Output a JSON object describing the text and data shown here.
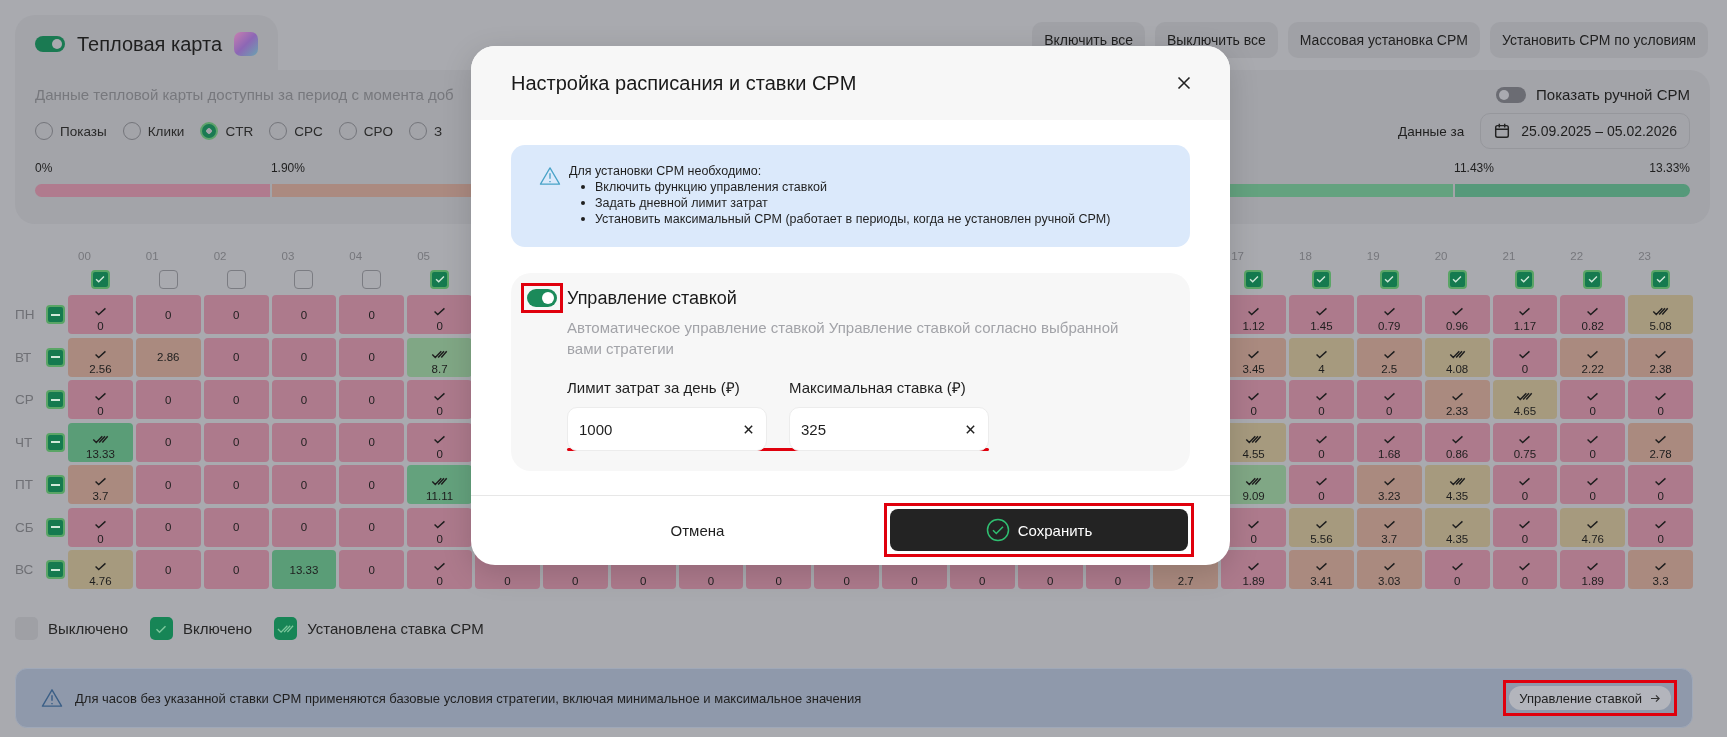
{
  "heatmap_tab": {
    "title": "Тепловая карта",
    "enabled": true
  },
  "toolbar_buttons": [
    "Включить все",
    "Выключить все",
    "Массовая установка CPM",
    "Установить CPM по условиям"
  ],
  "panel": {
    "description": "Данные тепловой карты доступны за период с момента доб",
    "manual_cpm_toggle": {
      "label": "Показать ручной CPM",
      "on": false
    },
    "metrics": [
      {
        "label": "Показы",
        "selected": false
      },
      {
        "label": "Клики",
        "selected": false
      },
      {
        "label": "CTR",
        "selected": true
      },
      {
        "label": "CPC",
        "selected": false
      },
      {
        "label": "CPO",
        "selected": false
      },
      {
        "label": "З",
        "selected": false
      }
    ],
    "period_label": "Данные за",
    "period": "25.09.2025 – 05.02.2026",
    "scale": {
      "segments": [
        {
          "label": "0%",
          "color": "#b07b8e"
        },
        {
          "label": "1.90%",
          "color": "#ab8a80"
        },
        {
          "color": "#64a27f"
        },
        {
          "label": "11.43%",
          "color": "#56997a"
        }
      ],
      "end_label": "13.33%"
    }
  },
  "heatmap": {
    "hours_left": [
      {
        "label": "00",
        "checked": true
      },
      {
        "label": "01",
        "checked": false
      },
      {
        "label": "02",
        "checked": false
      },
      {
        "label": "03",
        "checked": false
      },
      {
        "label": "04",
        "checked": false
      },
      {
        "label": "05",
        "checked": true
      }
    ],
    "hours_right": [
      {
        "label": "17",
        "checked": true
      },
      {
        "label": "18",
        "checked": true
      },
      {
        "label": "19",
        "checked": true
      },
      {
        "label": "20",
        "checked": true
      },
      {
        "label": "21",
        "checked": true
      },
      {
        "label": "22",
        "checked": true
      },
      {
        "label": "23",
        "checked": true
      }
    ],
    "days": [
      {
        "label": "ПН",
        "indeterminate": true,
        "cells_left": [
          {
            "value": "0",
            "kind": "check",
            "color": "#ad7a8c"
          },
          {
            "value": "0",
            "kind": "plain",
            "color": "#ad7a8c"
          },
          {
            "value": "0",
            "kind": "plain",
            "color": "#ad7a8c"
          },
          {
            "value": "0",
            "kind": "plain",
            "color": "#ad7a8c"
          },
          {
            "value": "0",
            "kind": "plain",
            "color": "#ad7a8c"
          },
          {
            "value": "0",
            "kind": "check",
            "color": "#ad7a8c"
          }
        ],
        "cells_right": [
          {
            "value": "1.12",
            "kind": "check",
            "color": "#ad7a8c"
          },
          {
            "value": "1.45",
            "kind": "check",
            "color": "#ad7a8c"
          },
          {
            "value": "0.79",
            "kind": "check",
            "color": "#ad7a8c"
          },
          {
            "value": "0.96",
            "kind": "check",
            "color": "#ad7a8c"
          },
          {
            "value": "1.17",
            "kind": "check",
            "color": "#ad7a8c"
          },
          {
            "value": "0.82",
            "kind": "check",
            "color": "#ad7a8c"
          },
          {
            "value": "5.08",
            "kind": "double",
            "color": "#a69a7e"
          }
        ]
      },
      {
        "label": "ВТ",
        "indeterminate": true,
        "cells_left": [
          {
            "value": "2.56",
            "kind": "check",
            "color": "#aa8a7f"
          },
          {
            "value": "2.86",
            "kind": "plain",
            "color": "#aa8a7f"
          },
          {
            "value": "0",
            "kind": "plain",
            "color": "#ad7a8c"
          },
          {
            "value": "0",
            "kind": "plain",
            "color": "#ad7a8c"
          },
          {
            "value": "0",
            "kind": "plain",
            "color": "#ad7a8c"
          },
          {
            "value": "8.7",
            "kind": "double",
            "color": "#80a785"
          }
        ],
        "cells_right": [
          {
            "value": "3.45",
            "kind": "check",
            "color": "#aa8a7f"
          },
          {
            "value": "4",
            "kind": "check",
            "color": "#a69a7e"
          },
          {
            "value": "2.5",
            "kind": "check",
            "color": "#aa8a7f"
          },
          {
            "value": "4.08",
            "kind": "double",
            "color": "#a69a7e"
          },
          {
            "value": "0",
            "kind": "check",
            "color": "#ad7a8c"
          },
          {
            "value": "2.22",
            "kind": "check",
            "color": "#aa8a7f"
          },
          {
            "value": "2.38",
            "kind": "check",
            "color": "#aa8a7f"
          }
        ]
      },
      {
        "label": "СР",
        "indeterminate": true,
        "cells_left": [
          {
            "value": "0",
            "kind": "check",
            "color": "#ad7a8c"
          },
          {
            "value": "0",
            "kind": "plain",
            "color": "#ad7a8c"
          },
          {
            "value": "0",
            "kind": "plain",
            "color": "#ad7a8c"
          },
          {
            "value": "0",
            "kind": "plain",
            "color": "#ad7a8c"
          },
          {
            "value": "0",
            "kind": "plain",
            "color": "#ad7a8c"
          },
          {
            "value": "0",
            "kind": "check",
            "color": "#ad7a8c"
          }
        ],
        "cells_right": [
          {
            "value": "0",
            "kind": "check",
            "color": "#ad7a8c"
          },
          {
            "value": "0",
            "kind": "check",
            "color": "#ad7a8c"
          },
          {
            "value": "0",
            "kind": "check",
            "color": "#ad7a8c"
          },
          {
            "value": "2.33",
            "kind": "check",
            "color": "#aa8a7f"
          },
          {
            "value": "4.65",
            "kind": "double",
            "color": "#a69a7e"
          },
          {
            "value": "0",
            "kind": "check",
            "color": "#ad7a8c"
          },
          {
            "value": "0",
            "kind": "check",
            "color": "#ad7a8c"
          }
        ]
      },
      {
        "label": "ЧТ",
        "indeterminate": true,
        "cells_left": [
          {
            "value": "13.33",
            "kind": "double",
            "color": "#5a9d77"
          },
          {
            "value": "0",
            "kind": "plain",
            "color": "#ad7a8c"
          },
          {
            "value": "0",
            "kind": "plain",
            "color": "#ad7a8c"
          },
          {
            "value": "0",
            "kind": "plain",
            "color": "#ad7a8c"
          },
          {
            "value": "0",
            "kind": "plain",
            "color": "#ad7a8c"
          },
          {
            "value": "0",
            "kind": "check",
            "color": "#ad7a8c"
          }
        ],
        "cells_right": [
          {
            "value": "4.55",
            "kind": "double",
            "color": "#a69a7e"
          },
          {
            "value": "0",
            "kind": "check",
            "color": "#ad7a8c"
          },
          {
            "value": "1.68",
            "kind": "check",
            "color": "#ad7a8c"
          },
          {
            "value": "0.86",
            "kind": "check",
            "color": "#ad7a8c"
          },
          {
            "value": "0.75",
            "kind": "check",
            "color": "#ad7a8c"
          },
          {
            "value": "0",
            "kind": "check",
            "color": "#ad7a8c"
          },
          {
            "value": "2.78",
            "kind": "check",
            "color": "#aa8a7f"
          }
        ]
      },
      {
        "label": "ПТ",
        "indeterminate": true,
        "cells_left": [
          {
            "value": "3.7",
            "kind": "check",
            "color": "#aa8a7f"
          },
          {
            "value": "0",
            "kind": "plain",
            "color": "#ad7a8c"
          },
          {
            "value": "0",
            "kind": "plain",
            "color": "#ad7a8c"
          },
          {
            "value": "0",
            "kind": "plain",
            "color": "#ad7a8c"
          },
          {
            "value": "0",
            "kind": "plain",
            "color": "#ad7a8c"
          },
          {
            "value": "11.11",
            "kind": "double",
            "color": "#64a27d"
          }
        ],
        "cells_right": [
          {
            "value": "9.09",
            "kind": "double",
            "color": "#80a785"
          },
          {
            "value": "0",
            "kind": "check",
            "color": "#ad7a8c"
          },
          {
            "value": "3.23",
            "kind": "check",
            "color": "#aa8a7f"
          },
          {
            "value": "4.35",
            "kind": "double",
            "color": "#a69a7e"
          },
          {
            "value": "0",
            "kind": "check",
            "color": "#ad7a8c"
          },
          {
            "value": "0",
            "kind": "check",
            "color": "#ad7a8c"
          },
          {
            "value": "0",
            "kind": "check",
            "color": "#ad7a8c"
          }
        ]
      },
      {
        "label": "СБ",
        "indeterminate": true,
        "cells_left": [
          {
            "value": "0",
            "kind": "check",
            "color": "#ad7a8c"
          },
          {
            "value": "0",
            "kind": "plain",
            "color": "#ad7a8c"
          },
          {
            "value": "0",
            "kind": "plain",
            "color": "#ad7a8c"
          },
          {
            "value": "0",
            "kind": "plain",
            "color": "#ad7a8c"
          },
          {
            "value": "0",
            "kind": "plain",
            "color": "#ad7a8c"
          },
          {
            "value": "0",
            "kind": "check",
            "color": "#ad7a8c"
          }
        ],
        "cells_right": [
          {
            "value": "0",
            "kind": "check",
            "color": "#ad7a8c"
          },
          {
            "value": "5.56",
            "kind": "check",
            "color": "#a69a7e"
          },
          {
            "value": "3.7",
            "kind": "check",
            "color": "#aa8a7f"
          },
          {
            "value": "4.35",
            "kind": "check",
            "color": "#a69a7e"
          },
          {
            "value": "0",
            "kind": "check",
            "color": "#ad7a8c"
          },
          {
            "value": "4.76",
            "kind": "check",
            "color": "#a69a7e"
          },
          {
            "value": "0",
            "kind": "check",
            "color": "#ad7a8c"
          }
        ]
      },
      {
        "label": "ВС",
        "indeterminate": true,
        "cells_left": [
          {
            "value": "4.76",
            "kind": "check",
            "color": "#a69a7e"
          },
          {
            "value": "0",
            "kind": "plain",
            "color": "#ad7a8c"
          },
          {
            "value": "0",
            "kind": "plain",
            "color": "#ad7a8c"
          },
          {
            "value": "13.33",
            "kind": "plain",
            "color": "#5a9d77"
          },
          {
            "value": "0",
            "kind": "plain",
            "color": "#ad7a8c"
          },
          {
            "value": "0",
            "kind": "check",
            "color": "#ad7a8c"
          }
        ],
        "cells_middle": [
          {
            "value": "0",
            "color": "#ad7a8c"
          },
          {
            "value": "0",
            "color": "#ad7a8c"
          },
          {
            "value": "0",
            "color": "#ad7a8c"
          },
          {
            "value": "0",
            "color": "#ad7a8c"
          },
          {
            "value": "0",
            "color": "#ad7a8c"
          },
          {
            "value": "0",
            "color": "#ad7a8c"
          },
          {
            "value": "0",
            "color": "#ad7a8c"
          },
          {
            "value": "0",
            "color": "#ad7a8c"
          },
          {
            "value": "0",
            "color": "#ad7a8c"
          },
          {
            "value": "0",
            "color": "#ad7a8c"
          },
          {
            "value": "2.7",
            "color": "#aa8a7f"
          }
        ],
        "cells_right": [
          {
            "value": "1.89",
            "kind": "check",
            "color": "#ad7a8c"
          },
          {
            "value": "3.41",
            "kind": "check",
            "color": "#aa8a7f"
          },
          {
            "value": "3.03",
            "kind": "check",
            "color": "#aa8a7f"
          },
          {
            "value": "0",
            "kind": "check",
            "color": "#ad7a8c"
          },
          {
            "value": "0",
            "kind": "check",
            "color": "#ad7a8c"
          },
          {
            "value": "1.89",
            "kind": "check",
            "color": "#ad7a8c"
          },
          {
            "value": "3.3",
            "kind": "check",
            "color": "#aa8a7f"
          }
        ]
      }
    ]
  },
  "legend": [
    {
      "kind": "off",
      "label": "Выключено"
    },
    {
      "kind": "on",
      "label": "Включено"
    },
    {
      "kind": "cpm",
      "label": "Установлена ставка CPM"
    }
  ],
  "info_bar": {
    "text": "Для часов без указанной ставки CPM применяются базовые условия стратегии, включая минимальное и максимальное значения",
    "button": {
      "label": "Управление ставкой",
      "highlighted": true
    }
  },
  "modal": {
    "title": "Настройка расписания и ставки CPM",
    "notice": {
      "heading": "Для установки CPM необходимо:",
      "items": [
        "Включить функцию управления ставкой",
        "Задать дневной лимит затрат",
        "Установить максимальный CPM (работает в периоды, когда не установлен ручной CPM)"
      ]
    },
    "bid_control": {
      "title": "Управление ставкой",
      "on": true,
      "highlighted": true,
      "description": "Автоматическое управление ставкой Управление ставкой согласно выбранной вами стратегии",
      "fields": [
        {
          "label": "Лимит затрат за день (₽)",
          "value": "1000"
        },
        {
          "label": "Максимальная ставка (₽)",
          "value": "325"
        }
      ],
      "fields_highlighted": true
    },
    "cancel": "Отмена",
    "save": {
      "label": "Сохранить",
      "highlighted": true
    }
  }
}
